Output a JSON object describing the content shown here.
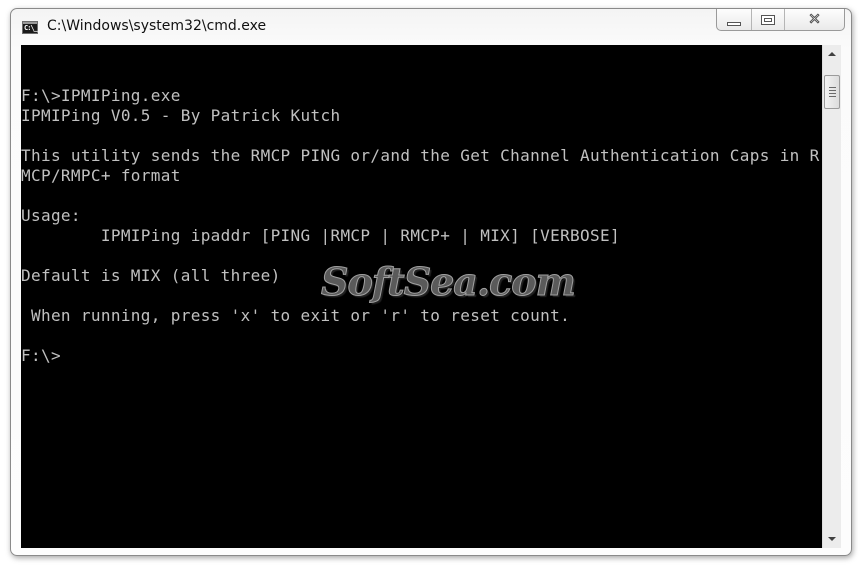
{
  "window": {
    "title": "C:\\Windows\\system32\\cmd.exe",
    "icon": "console-icon",
    "icon_text": "C:\\_",
    "buttons": {
      "minimize": "minimize-icon",
      "maximize": "maximize-icon",
      "close": "close-icon",
      "close_glyph": "✕"
    }
  },
  "console": {
    "background": "#000000",
    "foreground": "#c0c0c0",
    "lines": [
      "",
      "F:\\>IPMIPing.exe",
      "IPMIPing V0.5 - By Patrick Kutch",
      "",
      "This utility sends the RMCP PING or/and the Get Channel Authentication Caps in R",
      "MCP/RMPC+ format",
      "",
      "Usage:",
      "        IPMIPing ipaddr [PING |RMCP | RMCP+ | MIX] [VERBOSE]",
      "",
      "Default is MIX (all three)",
      "",
      " When running, press 'x' to exit or 'r' to reset count.",
      "",
      "F:\\>"
    ]
  },
  "watermark": {
    "text": "SoftSea.com"
  },
  "scrollbar": {
    "up_icon": "scroll-up-arrow-icon",
    "down_icon": "scroll-down-arrow-icon"
  }
}
